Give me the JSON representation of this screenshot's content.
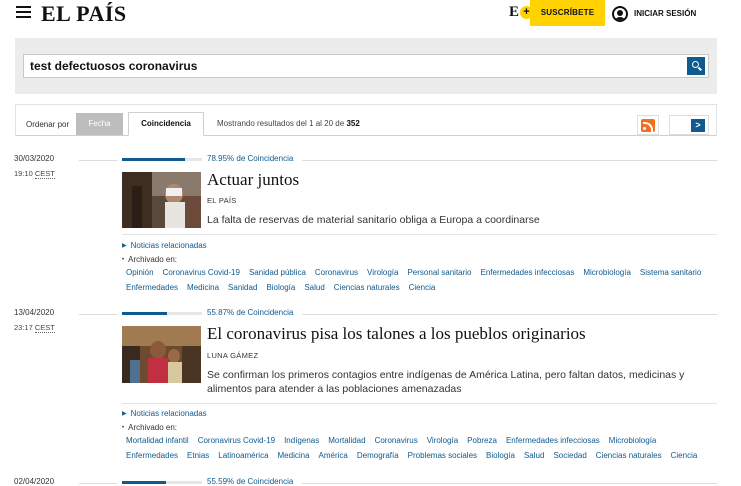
{
  "header": {
    "logo": "EL PAÍS",
    "e_letter": "E",
    "plus_symbol": "+",
    "subscribe_label": "SUSCRÍBETE",
    "login_label": "INICIAR SESIÓN",
    "icons": {
      "menu": "hamburger-menu-icon",
      "user": "user-icon"
    },
    "colors": {
      "accent_yellow": "#ffd200",
      "link_blue": "#0f5a8e"
    }
  },
  "search": {
    "query": "test defectuosos coronavirus",
    "button_icon": "search-icon"
  },
  "sort": {
    "label": "Ordenar por",
    "tab_date": "Fecha",
    "tab_relevance": "Coincidencia",
    "active_tab": "Coincidencia",
    "results_prefix": "Mostrando resultados del 1 al 20 de",
    "results_total": "352",
    "pager_next": ">"
  },
  "results": [
    {
      "date": "30/03/2020",
      "time": "19:10",
      "tz": "CEST",
      "relevance": 78.95,
      "relevance_text": "78.95%",
      "relevance_suffix": "de Coincidencia",
      "title": "Actuar juntos",
      "author": "EL PAÍS",
      "summary": "La falta de reservas de material sanitario obliga a Europa a coordinarse",
      "related_label": "Noticias relacionadas",
      "archived_label": "Archivado en:",
      "tags": [
        "Opinión",
        "Coronavirus Covid-19",
        "Sanidad pública",
        "Coronavirus",
        "Virología",
        "Personal sanitario",
        "Enfermedades infecciosas",
        "Microbiología",
        "Sistema sanitario",
        "Enfermedades",
        "Medicina",
        "Sanidad",
        "Biología",
        "Salud",
        "Ciencias naturales",
        "Ciencia"
      ]
    },
    {
      "date": "13/04/2020",
      "time": "23:17",
      "tz": "CEST",
      "relevance": 55.87,
      "relevance_text": "55.87%",
      "relevance_suffix": "de Coincidencia",
      "title": "El coronavirus pisa los talones a los pueblos originarios",
      "author": "LUNA GÁMEZ",
      "summary": "Se confirman los primeros contagios entre indígenas de América Latina, pero faltan datos, medicinas y alimentos para atender a las poblaciones amenazadas",
      "related_label": "Noticias relacionadas",
      "archived_label": "Archivado en:",
      "tags": [
        "Mortalidad infantil",
        "Coronavirus Covid-19",
        "Indígenas",
        "Mortalidad",
        "Coronavirus",
        "Virología",
        "Pobreza",
        "Enfermedades infecciosas",
        "Microbiología",
        "Enfermedades",
        "Etnias",
        "Latinoamérica",
        "Medicina",
        "América",
        "Demografía",
        "Problemas sociales",
        "Biología",
        "Salud",
        "Sociedad",
        "Ciencias naturales",
        "Ciencia"
      ]
    },
    {
      "date": "02/04/2020",
      "relevance": 55.59,
      "relevance_text": "55.59%",
      "relevance_suffix": "de Coincidencia"
    }
  ]
}
